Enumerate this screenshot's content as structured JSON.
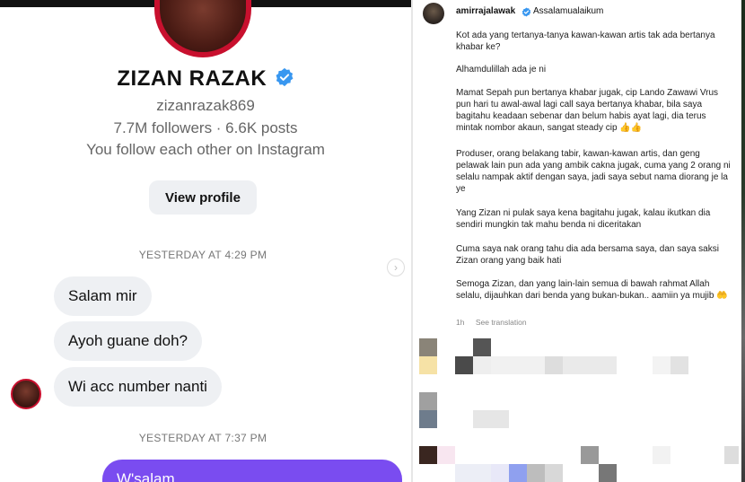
{
  "dm": {
    "profile": {
      "name": "ZIZAN RAZAK",
      "handle": "zizanrazak869",
      "stats": "7.7M followers · 6.6K posts",
      "mutual": "You follow each other on Instagram",
      "view_profile_label": "View profile"
    },
    "timestamps": [
      "YESTERDAY AT 4:29 PM",
      "YESTERDAY AT 7:37 PM"
    ],
    "received_messages": [
      "Salam mir",
      "Ayoh guane doh?",
      "Wi acc number nanti"
    ],
    "sent_message": "W'salam",
    "scroll_icon": "chevron-right-circle-icon",
    "accent_color": "#7a4cf0",
    "verified_color": "#3897f0"
  },
  "post": {
    "username": "amirrajalawak",
    "first_line": "Assalamualaikum",
    "paragraphs": [
      "Kot ada yang tertanya-tanya kawan-kawan artis tak ada bertanya khabar ke?",
      "Alhamdulillah ada je ni",
      "Mamat Sepah pun bertanya khabar jugak, cip Lando Zawawi Vrus pun hari tu awal-awal lagi call saya bertanya khabar, bila saya bagitahu keadaan sebenar dan belum habis ayat lagi, dia terus mintak nombor akaun, sangat steady cip 👍👍",
      "Produser, orang belakang tabir, kawan-kawan artis, dan geng pelawak lain pun ada yang ambik cakna jugak, cuma yang 2 orang ni selalu nampak aktif dengan saya, jadi saya sebut nama diorang je la ye",
      "Yang Zizan ni pulak saya kena bagitahu jugak, kalau ikutkan dia sendiri mungkin tak mahu benda ni diceritakan",
      "Cuma saya nak orang tahu dia ada bersama saya, dan saya saksi Zizan orang yang baik hati",
      "Semoga Zizan, dan yang lain-lain semua di bawah rahmat Allah selalu, dijauhkan dari benda yang bukan-bukan.. aamiin ya mujib 🤲"
    ],
    "time_ago": "1h",
    "see_translation": "See translation"
  }
}
